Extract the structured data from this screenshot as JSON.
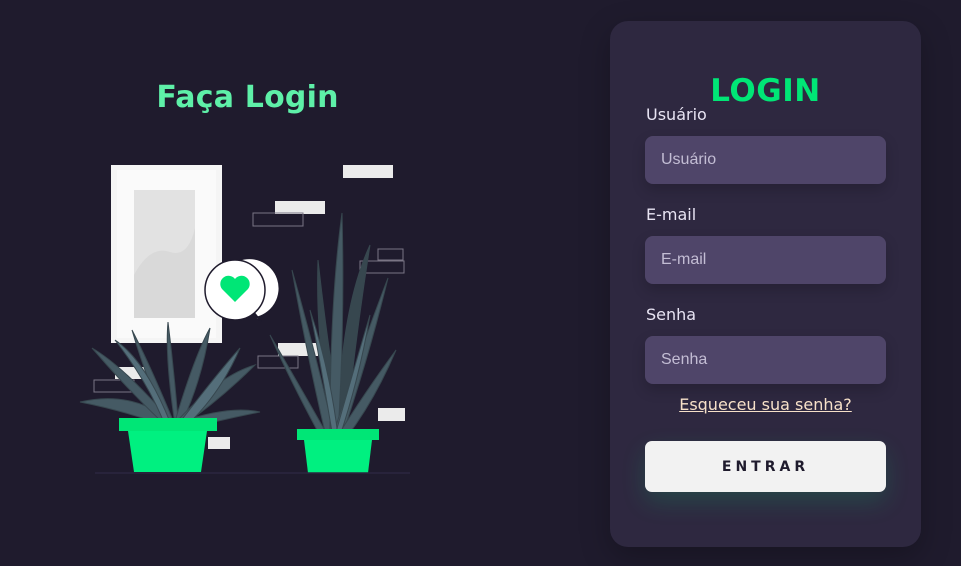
{
  "left": {
    "title": "Faça Login"
  },
  "login_card": {
    "title": "LOGIN",
    "fields": [
      {
        "label": "Usuário",
        "placeholder": "Usuário",
        "value": ""
      },
      {
        "label": "E-mail",
        "placeholder": "E-mail",
        "value": ""
      },
      {
        "label": "Senha",
        "placeholder": "Senha",
        "value": ""
      }
    ],
    "forgot_link": "Esqueceu sua senha?",
    "submit_label": "ENTRAR"
  },
  "colors": {
    "background": "#1f1b2d",
    "card": "#2e2840",
    "input": "#4f4569",
    "accent_green": "#00e676",
    "title_green": "#5ef0a8",
    "link": "#f7e1c9"
  },
  "icons": [
    "heart-icon"
  ]
}
